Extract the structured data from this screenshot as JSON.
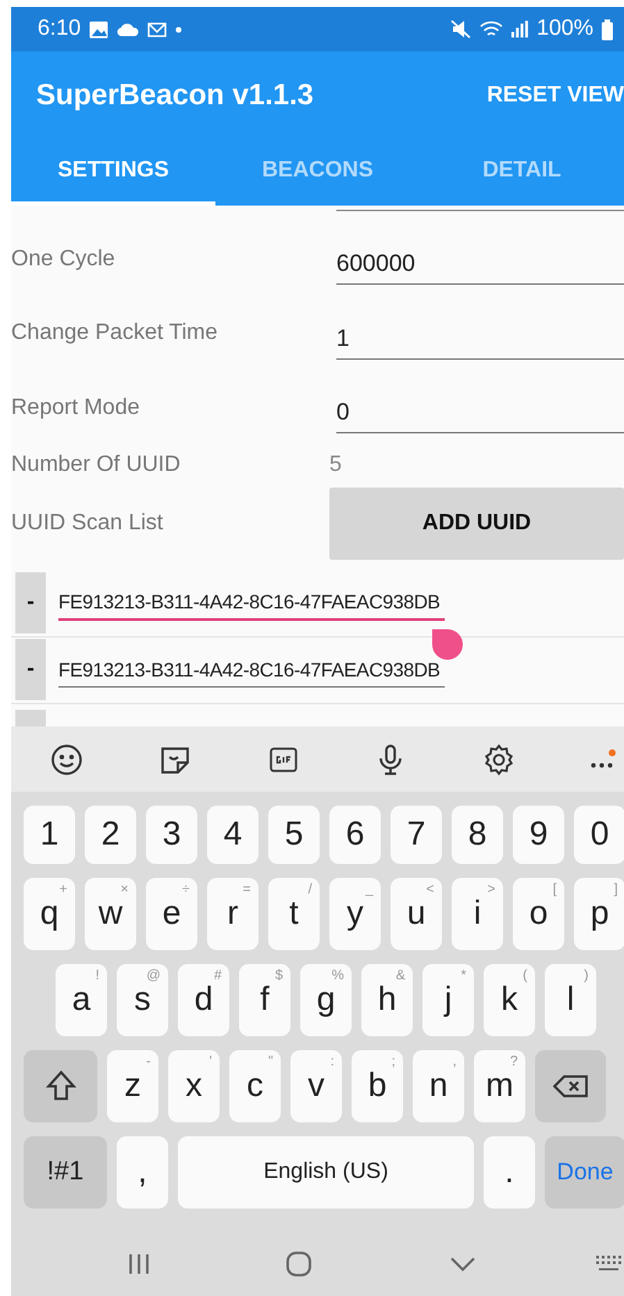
{
  "status_bar": {
    "time": "6:10",
    "battery": "100%"
  },
  "app_bar": {
    "title": "SuperBeacon v1.1.3",
    "action": "RESET VIEW"
  },
  "tabs": [
    {
      "label": "SETTINGS",
      "selected": true
    },
    {
      "label": "BEACONS",
      "selected": false
    },
    {
      "label": "DETAIL",
      "selected": false
    }
  ],
  "settings": [
    {
      "kind": "field",
      "label": "One Cycle",
      "value": "600000"
    },
    {
      "kind": "field",
      "label": "Change Packet Time",
      "value": "1"
    },
    {
      "kind": "field",
      "label": "Report Mode",
      "value": "0"
    },
    {
      "kind": "text",
      "label": "Number Of UUID",
      "value": "5"
    },
    {
      "kind": "button",
      "label": "UUID Scan List",
      "value": "ADD UUID"
    }
  ],
  "uuid_list": [
    {
      "remove": "-",
      "value": "FE913213-B311-4A42-8C16-47FAEAC938DB",
      "focused": true
    },
    {
      "remove": "-",
      "value": "FE913213-B311-4A42-8C16-47FAEAC938DB",
      "focused": false
    }
  ],
  "keyboard": {
    "rows": [
      [
        {
          "kind": "char",
          "label": "1"
        },
        {
          "kind": "char",
          "label": "2"
        },
        {
          "kind": "char",
          "label": "3"
        },
        {
          "kind": "char",
          "label": "4"
        },
        {
          "kind": "char",
          "label": "5"
        },
        {
          "kind": "char",
          "label": "6"
        },
        {
          "kind": "char",
          "label": "7"
        },
        {
          "kind": "char",
          "label": "8"
        },
        {
          "kind": "char",
          "label": "9"
        },
        {
          "kind": "char",
          "label": "0"
        }
      ],
      [
        {
          "kind": "char",
          "label": "q",
          "hint": "+"
        },
        {
          "kind": "char",
          "label": "w",
          "hint": "×"
        },
        {
          "kind": "char",
          "label": "e",
          "hint": "÷"
        },
        {
          "kind": "char",
          "label": "r",
          "hint": "="
        },
        {
          "kind": "char",
          "label": "t",
          "hint": "/"
        },
        {
          "kind": "char",
          "label": "y",
          "hint": "_"
        },
        {
          "kind": "char",
          "label": "u",
          "hint": "<"
        },
        {
          "kind": "char",
          "label": "i",
          "hint": ">"
        },
        {
          "kind": "char",
          "label": "o",
          "hint": "["
        },
        {
          "kind": "char",
          "label": "p",
          "hint": "]"
        }
      ],
      [
        {
          "kind": "char",
          "label": "a",
          "hint": "!"
        },
        {
          "kind": "char",
          "label": "s",
          "hint": "@"
        },
        {
          "kind": "char",
          "label": "d",
          "hint": "#"
        },
        {
          "kind": "char",
          "label": "f",
          "hint": "$"
        },
        {
          "kind": "char",
          "label": "g",
          "hint": "%"
        },
        {
          "kind": "char",
          "label": "h",
          "hint": "&"
        },
        {
          "kind": "char",
          "label": "j",
          "hint": "*"
        },
        {
          "kind": "char",
          "label": "k",
          "hint": "("
        },
        {
          "kind": "char",
          "label": "l",
          "hint": ")"
        }
      ],
      [
        {
          "kind": "shift"
        },
        {
          "kind": "char",
          "label": "z",
          "hint": "-"
        },
        {
          "kind": "char",
          "label": "x",
          "hint": "'"
        },
        {
          "kind": "char",
          "label": "c",
          "hint": "\""
        },
        {
          "kind": "char",
          "label": "v",
          "hint": ":"
        },
        {
          "kind": "char",
          "label": "b",
          "hint": ";"
        },
        {
          "kind": "char",
          "label": "n",
          "hint": ","
        },
        {
          "kind": "char",
          "label": "m",
          "hint": "?"
        },
        {
          "kind": "backspace"
        }
      ]
    ],
    "bottom_bar": [
      {
        "kind": "symbols",
        "label": "!#1"
      },
      {
        "kind": "char",
        "label": ","
      },
      {
        "kind": "space",
        "label": "English (US)"
      },
      {
        "kind": "char",
        "label": "."
      },
      {
        "kind": "done",
        "label": "Done"
      }
    ]
  }
}
